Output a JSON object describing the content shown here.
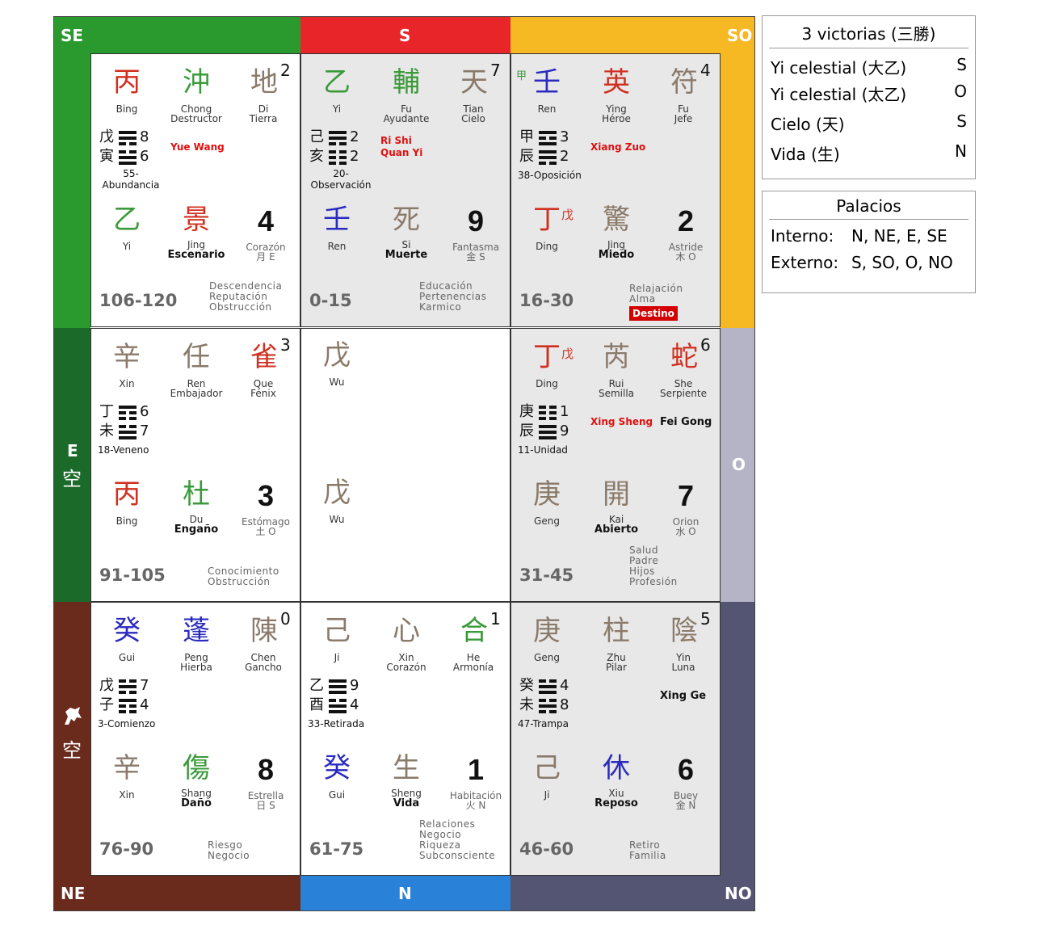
{
  "directions": {
    "se": "SE",
    "s": "S",
    "so": "SO",
    "e": "E",
    "e_void": "空",
    "o": "O",
    "ne": "NE",
    "ne_void": "空",
    "n": "N",
    "no": "NO"
  },
  "colors": {
    "se": "#2a9a2e",
    "s": "#e8262a",
    "so": "#f6b823",
    "e": "#1c6a2a",
    "o": "#b5b3c6",
    "ne": "#6a2a1c",
    "n": "#2a82d8",
    "no": "#545473"
  },
  "palaces": [
    {
      "id": "se",
      "grey": false,
      "heaven_stem": {
        "ch": "丙",
        "color": "#d03020",
        "label": "Bing"
      },
      "star_top": {
        "ch": "沖",
        "color": "#3a9a3a",
        "l1": "Chong",
        "l2": "Destructor",
        "bold": false
      },
      "deity": {
        "ch": "地",
        "color": "#8a7a6a",
        "l1": "Di",
        "l2": "Tierra"
      },
      "corner_num": "2",
      "hex": {
        "s1": "戊",
        "s2": "寅",
        "n1": "8",
        "n2": "6",
        "name1": "55-",
        "name2": "Abundancia",
        "lines": [
          [
            1,
            1,
            0
          ],
          [
            0,
            1,
            1
          ]
        ]
      },
      "notes_red": [
        "Yue Wang"
      ],
      "notes_black": [],
      "earth_stem": {
        "ch": "乙",
        "color": "#3a9a3a",
        "label": "Yi",
        "extra": ""
      },
      "door": {
        "ch": "景",
        "color": "#d03020",
        "l1": "Jing",
        "l2": "Escenario"
      },
      "palace_num": "4",
      "star": {
        "l1": "Corazón",
        "l2": "月 E"
      },
      "age": "106-120",
      "aspects": [
        "Descendencia",
        "Reputación",
        "Obstrucción"
      ],
      "destino": ""
    },
    {
      "id": "s",
      "grey": true,
      "heaven_stem": {
        "ch": "乙",
        "color": "#3a9a3a",
        "label": "Yi"
      },
      "star_top": {
        "ch": "輔",
        "color": "#3a9a3a",
        "l1": "Fu",
        "l2": "Ayudante",
        "bold": false
      },
      "deity": {
        "ch": "天",
        "color": "#8a7a6a",
        "l1": "Tian",
        "l2": "Cielo"
      },
      "corner_num": "7",
      "hex": {
        "s1": "己",
        "s2": "亥",
        "n1": "2",
        "n2": "2",
        "name1": "20-",
        "name2": "Observación",
        "lines": [
          [
            1,
            1,
            0
          ],
          [
            0,
            0,
            0
          ]
        ]
      },
      "notes_red": [
        "Ri Shi",
        "Quan Yi"
      ],
      "notes_black": [],
      "earth_stem": {
        "ch": "壬",
        "color": "#2a2ac0",
        "label": "Ren",
        "extra": ""
      },
      "door": {
        "ch": "死",
        "color": "#8a7a6a",
        "l1": "Si",
        "l2": "Muerte"
      },
      "palace_num": "9",
      "star": {
        "l1": "Fantasma",
        "l2": "金 S"
      },
      "age": "0-15",
      "aspects": [
        "Educación",
        "Pertenencias",
        "Karmico"
      ],
      "destino": ""
    },
    {
      "id": "so",
      "grey": true,
      "heaven_stem": {
        "ch": "壬",
        "color": "#2a2ac0",
        "label": "Ren",
        "prefix": "甲"
      },
      "star_top": {
        "ch": "英",
        "color": "#d03020",
        "l1": "Ying",
        "l2": "Héroe",
        "bold": false
      },
      "deity": {
        "ch": "符",
        "color": "#8a7a6a",
        "l1": "Fu",
        "l2": "Jefe"
      },
      "corner_num": "4",
      "hex": {
        "s1": "甲",
        "s2": "辰",
        "n1": "3",
        "n2": "2",
        "name1": "38-Oposición",
        "name2": "",
        "lines": [
          [
            1,
            0,
            1
          ],
          [
            1,
            1,
            0
          ]
        ]
      },
      "notes_red": [
        "Xiang Zuo"
      ],
      "notes_black": [],
      "earth_stem": {
        "ch": "丁",
        "color": "#d03020",
        "label": "Ding",
        "extra": "戊"
      },
      "door": {
        "ch": "驚",
        "color": "#8a7a6a",
        "l1": "Jing",
        "l2": "Miedo"
      },
      "palace_num": "2",
      "star": {
        "l1": "Astride",
        "l2": "木 O"
      },
      "age": "16-30",
      "aspects": [
        "Relajación",
        "Alma"
      ],
      "destino": "Destino"
    },
    {
      "id": "e",
      "grey": false,
      "heaven_stem": {
        "ch": "辛",
        "color": "#8a7a6a",
        "label": "Xin"
      },
      "star_top": {
        "ch": "任",
        "color": "#8a7a6a",
        "l1": "Ren",
        "l2": "Embajador",
        "bold": false
      },
      "deity": {
        "ch": "雀",
        "color": "#d03020",
        "l1": "Que",
        "l2": "Fénix"
      },
      "corner_num": "3",
      "hex": {
        "s1": "丁",
        "s2": "未",
        "n1": "6",
        "n2": "7",
        "name1": "18-Veneno",
        "name2": "",
        "lines": [
          [
            1,
            0,
            0
          ],
          [
            0,
            1,
            1
          ]
        ]
      },
      "notes_red": [],
      "notes_black": [],
      "earth_stem": {
        "ch": "丙",
        "color": "#d03020",
        "label": "Bing",
        "extra": ""
      },
      "door": {
        "ch": "杜",
        "color": "#3a9a3a",
        "l1": "Du",
        "l2": "Engaño"
      },
      "palace_num": "3",
      "star": {
        "l1": "Estómago",
        "l2": "土 O"
      },
      "age": "91-105",
      "aspects": [
        "Conocimiento",
        "Obstrucción"
      ],
      "destino": ""
    },
    {
      "id": "c",
      "grey": false,
      "center": true,
      "top": {
        "ch": "戊",
        "color": "#8a7a6a",
        "label": "Wu"
      },
      "bottom": {
        "ch": "戊",
        "color": "#8a7a6a",
        "label": "Wu"
      }
    },
    {
      "id": "o",
      "grey": true,
      "heaven_stem": {
        "ch": "丁",
        "color": "#d03020",
        "label": "Ding",
        "suffix": "戊"
      },
      "star_top": {
        "ch": "芮",
        "color": "#8a7a6a",
        "l1": "Rui",
        "l2": "Semilla",
        "bold": false
      },
      "deity": {
        "ch": "蛇",
        "color": "#d03020",
        "l1": "She",
        "l2": "Serpiente"
      },
      "corner_num": "6",
      "hex": {
        "s1": "庚",
        "s2": "辰",
        "n1": "1",
        "n2": "9",
        "name1": "11-Unidad",
        "name2": "",
        "lines": [
          [
            0,
            0,
            0
          ],
          [
            1,
            1,
            1
          ]
        ]
      },
      "notes_red": [
        "Xing Sheng"
      ],
      "notes_black": [
        "Fei Gong"
      ],
      "earth_stem": {
        "ch": "庚",
        "color": "#8a7a6a",
        "label": "Geng",
        "extra": ""
      },
      "door": {
        "ch": "開",
        "color": "#8a7a6a",
        "l1": "Kai",
        "l2": "Abierto"
      },
      "palace_num": "7",
      "star": {
        "l1": "Orion",
        "l2": "水 O"
      },
      "age": "31-45",
      "aspects": [
        "Salud",
        "Padre",
        "Hijos",
        "Profesión"
      ],
      "destino": ""
    },
    {
      "id": "ne",
      "grey": false,
      "heaven_stem": {
        "ch": "癸",
        "color": "#2a2ac0",
        "label": "Gui"
      },
      "star_top": {
        "ch": "蓬",
        "color": "#2a2ac0",
        "l1": "Peng",
        "l2": "Hierba",
        "bold": false
      },
      "deity": {
        "ch": "陳",
        "color": "#8a7a6a",
        "l1": "Chen",
        "l2": "Gancho"
      },
      "corner_num": "0",
      "hex": {
        "s1": "戊",
        "s2": "子",
        "n1": "7",
        "n2": "4",
        "name1": "3-Comienzo",
        "name2": "",
        "lines": [
          [
            0,
            1,
            0
          ],
          [
            1,
            0,
            0
          ]
        ]
      },
      "notes_red": [],
      "notes_black": [],
      "earth_stem": {
        "ch": "辛",
        "color": "#8a7a6a",
        "label": "Xin",
        "extra": ""
      },
      "door": {
        "ch": "傷",
        "color": "#3a9a3a",
        "l1": "Shang",
        "l2": "Daño"
      },
      "palace_num": "8",
      "star": {
        "l1": "Estrella",
        "l2": "日 S"
      },
      "age": "76-90",
      "aspects": [
        "Riesgo",
        "Negocio"
      ],
      "destino": ""
    },
    {
      "id": "n",
      "grey": false,
      "heaven_stem": {
        "ch": "己",
        "color": "#8a7a6a",
        "label": "Ji"
      },
      "star_top": {
        "ch": "心",
        "color": "#8a7a6a",
        "l1": "Xin",
        "l2": "Corazón",
        "bold": false
      },
      "deity": {
        "ch": "合",
        "color": "#3a9a3a",
        "l1": "He",
        "l2": "Armonía"
      },
      "corner_num": "1",
      "hex": {
        "s1": "乙",
        "s2": "酉",
        "n1": "9",
        "n2": "4",
        "name1": "33-Retirada",
        "name2": "",
        "lines": [
          [
            1,
            1,
            1
          ],
          [
            0,
            1,
            1
          ]
        ]
      },
      "notes_red": [],
      "notes_black": [],
      "earth_stem": {
        "ch": "癸",
        "color": "#2a2ac0",
        "label": "Gui",
        "extra": ""
      },
      "door": {
        "ch": "生",
        "color": "#8a7a6a",
        "l1": "Sheng",
        "l2": "Vida"
      },
      "palace_num": "1",
      "star": {
        "l1": "Habitación",
        "l2": "火 N"
      },
      "age": "61-75",
      "aspects": [
        "Relaciones",
        "Negocio",
        "Riqueza",
        "Subconsciente"
      ],
      "destino": ""
    },
    {
      "id": "no",
      "grey": true,
      "heaven_stem": {
        "ch": "庚",
        "color": "#8a7a6a",
        "label": "Geng"
      },
      "star_top": {
        "ch": "柱",
        "color": "#8a7a6a",
        "l1": "Zhu",
        "l2": "Pilar",
        "bold": false
      },
      "deity": {
        "ch": "陰",
        "color": "#8a7a6a",
        "l1": "Yin",
        "l2": "Luna"
      },
      "corner_num": "5",
      "hex": {
        "s1": "癸",
        "s2": "未",
        "n1": "4",
        "n2": "8",
        "name1": "47-Trampa",
        "name2": "",
        "lines": [
          [
            0,
            1,
            1
          ],
          [
            0,
            1,
            0
          ]
        ]
      },
      "notes_red": [],
      "notes_black": [
        "Xing Ge"
      ],
      "earth_stem": {
        "ch": "己",
        "color": "#8a7a6a",
        "label": "Ji",
        "extra": ""
      },
      "door": {
        "ch": "休",
        "color": "#2a2ac0",
        "l1": "Xiu",
        "l2": "Reposo"
      },
      "palace_num": "6",
      "star": {
        "l1": "Buey",
        "l2": "金 N"
      },
      "age": "46-60",
      "aspects": [
        "Retiro",
        "Familia"
      ],
      "destino": ""
    }
  ],
  "victorias": {
    "title": "3 victorias (三勝)",
    "rows": [
      {
        "label": "Yi celestial (大乙)",
        "dir": "S"
      },
      {
        "label": "Yi celestial (太乙)",
        "dir": "O"
      },
      {
        "label": "Cielo (天)",
        "dir": "S"
      },
      {
        "label": "Vida (生)",
        "dir": "N"
      }
    ]
  },
  "palacios": {
    "title": "Palacios",
    "rows": [
      {
        "label": "Interno:",
        "dirs": "N, NE, E, SE"
      },
      {
        "label": "Externo:",
        "dirs": "S, SO, O, NO"
      }
    ]
  }
}
